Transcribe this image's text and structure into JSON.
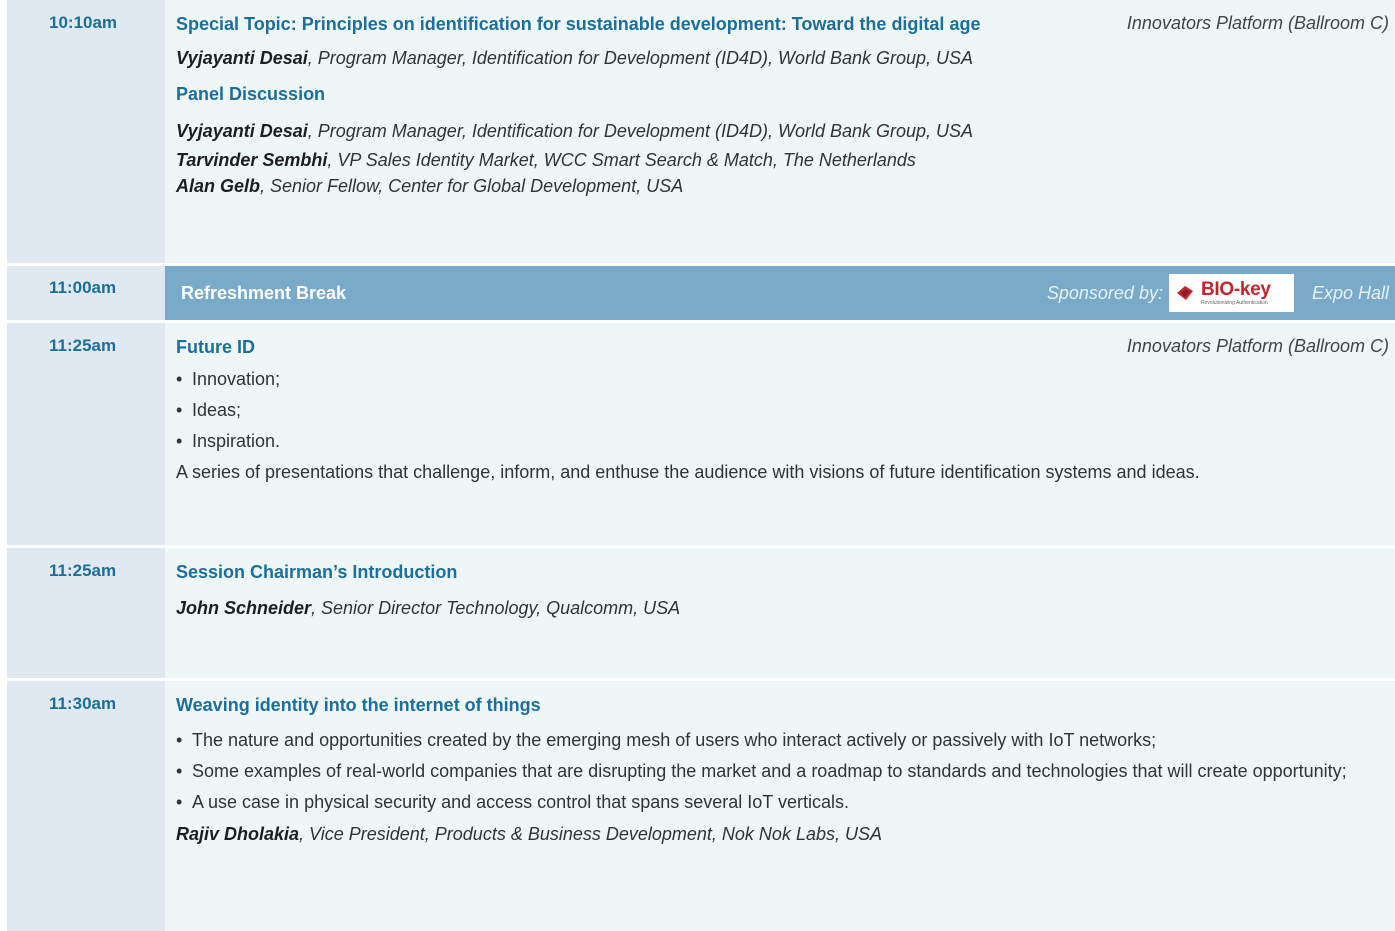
{
  "sessions": [
    {
      "time": "10:10am",
      "title": "Special Topic: Principles on identification for sustainable development: Toward the digital age",
      "location": "Innovators Platform (Ballroom C)",
      "speaker": {
        "name": "Vyjayanti Desai",
        "role": ", Program Manager, Identification for Development (ID4D), World Bank Group, USA"
      },
      "panel_title": "Panel Discussion",
      "panel_speakers": [
        {
          "name": "Vyjayanti Desai",
          "role": ", Program Manager, Identification for Development (ID4D), World Bank Group, USA"
        },
        {
          "name": "Tarvinder Sembhi",
          "role": ", VP Sales Identity Market, WCC Smart Search & Match, The Netherlands"
        },
        {
          "name": "Alan Gelb",
          "role": ", Senior Fellow, Center for Global Development, USA"
        }
      ]
    },
    {
      "time": "11:00am",
      "title": "Refreshment Break",
      "sponsored_label": "Sponsored by:",
      "sponsor_logo_text": "BIO-key",
      "sponsor_logo_tagline": "Revolutionizing Authentication",
      "location": "Expo Hall"
    },
    {
      "time": "11:25am",
      "title": "Future ID",
      "location": "Innovators Platform (Ballroom C)",
      "bullets": [
        "Innovation;",
        "Ideas;",
        "Inspiration."
      ],
      "description": "A series of presentations that challenge, inform, and enthuse the audience with visions of future identification systems and ideas."
    },
    {
      "time": "11:25am",
      "title": "Session Chairman’s Introduction",
      "speaker": {
        "name": "John Schneider",
        "role": ", Senior Director Technology, Qualcomm, USA"
      }
    },
    {
      "time": "11:30am",
      "title": "Weaving identity into the internet of things",
      "bullets": [
        "The nature and opportunities created by the emerging mesh of users who interact actively or passively with IoT networks;",
        "Some examples of real-world companies that are disrupting the market and a roadmap to standards and technologies that will create opportunity;",
        "A use case in physical security and access control that spans several IoT verticals."
      ],
      "speaker": {
        "name": "Rajiv Dholakia",
        "role": ", Vice President, Products & Business Development, Nok Nok Labs, USA"
      }
    }
  ],
  "bullet_glyph": "•",
  "colors": {
    "time_bg": "#e0e9f1",
    "content_bg": "#eef6f7",
    "break_bg": "#7aaac9",
    "accent_text": "#1c6f9a",
    "logo_red": "#c0262d"
  }
}
